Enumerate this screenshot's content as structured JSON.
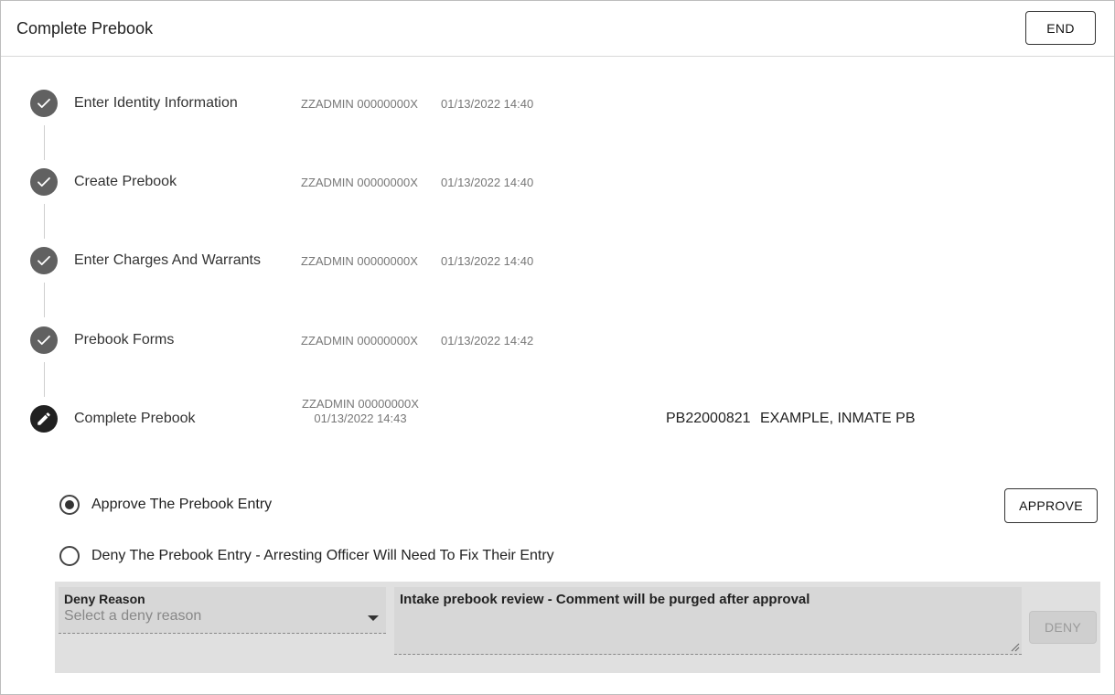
{
  "header": {
    "title": "Complete Prebook",
    "end_label": "END"
  },
  "steps": [
    {
      "name": "Enter Identity Information",
      "user": "ZZADMIN 00000000X",
      "time": "01/13/2022 14:40",
      "status": "done"
    },
    {
      "name": "Create Prebook",
      "user": "ZZADMIN 00000000X",
      "time": "01/13/2022 14:40",
      "status": "done"
    },
    {
      "name": "Enter Charges And Warrants",
      "user": "ZZADMIN 00000000X",
      "time": "01/13/2022 14:40",
      "status": "done"
    },
    {
      "name": "Prebook Forms",
      "user": "ZZADMIN 00000000X",
      "time": "01/13/2022 14:42",
      "status": "done"
    },
    {
      "name": "Complete Prebook",
      "user": "ZZADMIN 00000000X",
      "time": "01/13/2022 14:43",
      "status": "active"
    }
  ],
  "booking": {
    "number": "PB22000821",
    "name": "EXAMPLE, INMATE PB"
  },
  "options": {
    "approve_label": "Approve The Prebook Entry",
    "deny_label": "Deny The Prebook Entry - Arresting Officer Will Need To Fix Their Entry",
    "selected": "approve"
  },
  "approve_button": "APPROVE",
  "deny": {
    "reason_label": "Deny Reason",
    "reason_placeholder": "Select a deny reason",
    "comment": "Intake prebook review - Comment will be purged after approval",
    "button": "DENY"
  },
  "icons": {
    "done": "check-icon",
    "active": "pencil-icon",
    "select": "caret-down-icon"
  },
  "colors": {
    "done_circle": "#616161",
    "active_circle": "#212121",
    "panel": "#e0e0e0"
  }
}
